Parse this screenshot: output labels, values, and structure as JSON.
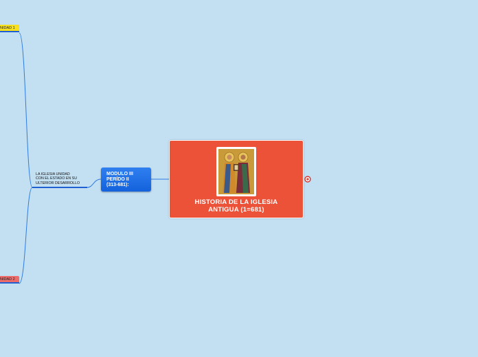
{
  "root": {
    "title_line1": "HISTORIA DE LA IGLESIA",
    "title_line2": "ANTIGUA (1=681)",
    "image": "icon-saints-peter-and-paul",
    "color": "#ec5238"
  },
  "module": {
    "line1": "MODULO III",
    "line2": "PERÍDO II",
    "line3": "(313-681):",
    "color": "#1a6ae6"
  },
  "topic": {
    "line1": "LA IGLESIA UNIDAD",
    "line2": "CON EL ESTADO EN SU",
    "line3": "ULTERIOR DESARROLLO"
  },
  "units": [
    {
      "label": "NIDAD 1",
      "color": "#f7e01c"
    },
    {
      "label": "NIDAD 2",
      "color": "#ec6b6b"
    }
  ],
  "colors": {
    "background": "#c3dff2",
    "connector": "#2e7be0"
  }
}
